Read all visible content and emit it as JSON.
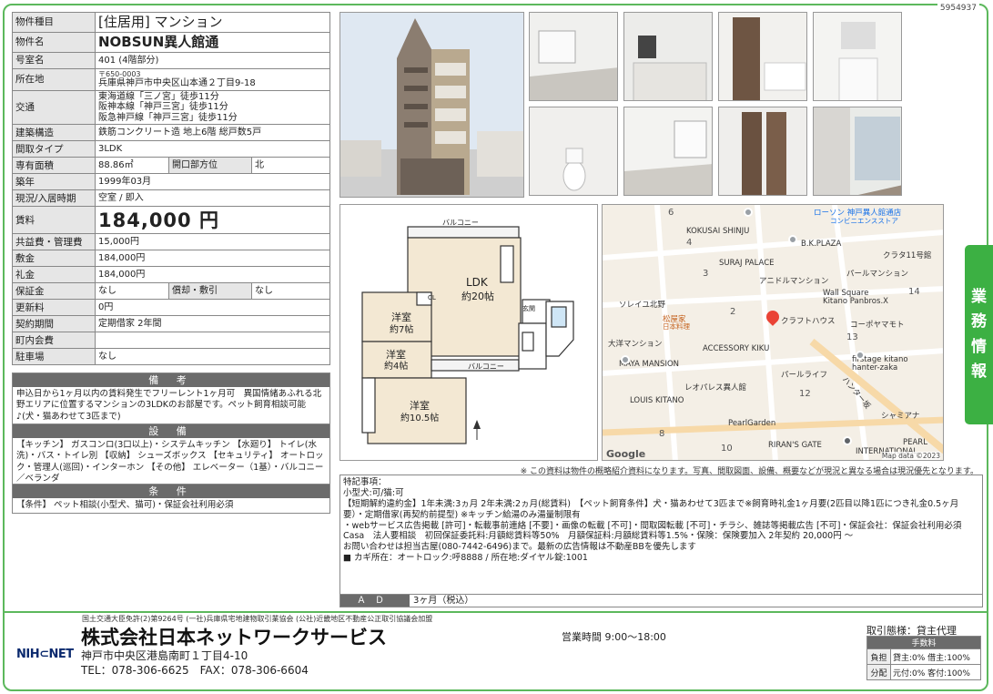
{
  "doc_id": "5954937",
  "property": {
    "type_label": "物件種目",
    "type_value": "[住居用] マンション",
    "name_label": "物件名",
    "name_value": "NOBSUN異人館通",
    "room_label": "号室名",
    "room_value": "401 (4階部分)",
    "address_label": "所在地",
    "postal": "〒650-0003",
    "address_value": "兵庫県神戸市中央区山本通２丁目9-18",
    "traffic_label": "交通",
    "traffic_lines": [
      "東海道線「三ノ宮」徒歩11分",
      "阪神本線「神戸三宮」徒歩11分",
      "阪急神戸線「神戸三宮」徒歩11分"
    ],
    "structure_label": "建築構造",
    "structure_value": "鉄筋コンクリート造 地上6階 総戸数5戸",
    "layout_label": "間取タイプ",
    "layout_value": "3LDK",
    "area_label": "専有面積",
    "area_value": "88.86㎡",
    "opening_label": "開口部方位",
    "opening_value": "北",
    "built_label": "築年",
    "built_value": "1999年03月",
    "status_label": "現況/入居時期",
    "status_value": "空室 / 即入",
    "rent_label": "賃料",
    "rent_value": "184,000 円",
    "fee_label": "共益費・管理費",
    "fee_value": "15,000円",
    "deposit_label": "敷金",
    "deposit_value": "184,000円",
    "keymoney_label": "礼金",
    "keymoney_value": "184,000円",
    "guarantee_label": "保証金",
    "guarantee_value": "なし",
    "amort_label": "償却・敷引",
    "amort_value": "なし",
    "renewal_label": "更新料",
    "renewal_value": "0円",
    "contract_label": "契約期間",
    "contract_value": "定期借家 2年間",
    "community_label": "町内会費",
    "community_value": "",
    "parking_label": "駐車場",
    "parking_value": "なし"
  },
  "notes": {
    "remarks_title": "備 考",
    "remarks_text": "申込日から1ヶ月以内の賃料発生でフリーレント1ヶ月可　異国情緒あふれる北野エリアに位置するマンションの3LDKのお部屋です。ペット飼育相談可能♪(犬・猫あわせて3匹まで)",
    "equip_title": "設 備",
    "equip_text": "【キッチン】 ガスコンロ(3口以上)・システムキッチン 【水廻り】 トイレ(水洗)・バス・トイレ別 【収納】 シューズボックス 【セキュリティ】 オートロック・管理人(巡回)・インターホン 【その他】 エレベーター（1基）・バルコニー／ベランダ",
    "cond_title": "条 件",
    "cond_text": "【条件】 ペット相談(小型犬、猫可)・保証会社利用必須"
  },
  "floorplan": {
    "balcony_top": "バルコニー",
    "balcony_mid": "バルコニー",
    "ldk": "LDK",
    "ldk_size": "約20帖",
    "room1": "洋室",
    "room1_size": "約7帖",
    "room2": "洋室",
    "room2_size": "約4帖",
    "room3": "洋室",
    "room3_size": "約10.5帖",
    "cl": "CL",
    "genkan": "玄関"
  },
  "map": {
    "labels": {
      "lawson": "ローソン 神戸異人館通店",
      "lawson_sub": "コンビニエンスストア",
      "kokusai": "KOKUSAI SHINJU",
      "bk": "B.K.PLAZA",
      "suraj": "SURAJ PALACE",
      "kurata": "クラタ11号館",
      "anidor": "アニドルマンション",
      "pearl_m": "パールマンション",
      "wall": "Wall Square",
      "kitano": "Kitano Panbros.X",
      "soleil": "ソレイユ北野",
      "matsuya": "松屋家",
      "matsuya_sub": "日本料理",
      "craft": "クラフトハウス",
      "kobeya": "コーポヤマモト",
      "taiyo": "大洋マンション",
      "accessory": "ACCESSORY KIKU",
      "firstage": "firstage kitano",
      "hanter": "hanter-zaka",
      "maya": "MAYA MANSION",
      "leo": "レオパレス異人館",
      "pearllife": "パールライフ",
      "louis": "LOUIS KITANO",
      "hunter": "ハンター坂",
      "shamiana": "シャミアナ",
      "pearlgarden": "PearlGarden",
      "riran": "RIRAN'S GATE",
      "pearl_int": "PEARL",
      "intl": "INTERNATIONAL",
      "google": "Google",
      "mapdata": "Map data ©2023"
    },
    "numbers": [
      "6",
      "4",
      "3",
      "2",
      "14",
      "13",
      "12",
      "8",
      "10"
    ]
  },
  "side_label": [
    "業",
    "務",
    "情",
    "報"
  ],
  "disclaimer": "※ この資料は物件の概略紹介資料になります。写真、間取図面、設備、概要などが現況と異なる場合は現況優先となります。",
  "special": {
    "title": "特記事項：",
    "lines": [
      "小型犬:可/猫:可",
      "【短期解約違約金】1年未満:3ヵ月 2年未満:2ヵ月(総賃料)　【ペット飼育条件】犬・猫あわせて3匹まで※飼育時礼金1ヶ月要(2匹目以降1匹につき礼金0.5ヶ月要）・定期借家(再契約前提型) ※キッチン給湯のみ湯量制限有",
      "・webサービス広告掲載 [許可]・転載事前連絡 [不要]・画像の転載 [不可]・間取図転載 [不可]・チラシ、雑誌等掲載広告 [不可]・保証会社：保証会社利用必須　Casa　法人要相談　初回保証委託料:月額総賃料等50%　月額保証料:月額総賃料等1.5%・保険：保険要加入 2年契約 20,000円 ～",
      "お問い合わせは担当古屋(080-7442-6496)まで。最新の広告情報は不動産BBを優先します",
      "■ カギ所在：オートロック:呼8888 / 所在地:ダイヤル錠:1001"
    ]
  },
  "ad": {
    "label": "ＡＤ",
    "value": "3ヶ月（税込）"
  },
  "company": {
    "license": "国土交通大臣免許(2)第9264号 (一社)兵庫県宅地建物取引業協会 (公社)近畿地区不動産公正取引協議会加盟",
    "name": "株式会社日本ネットワークサービス",
    "address": "神戸市中央区港島南町１丁目4-10",
    "tel": "TEL：078-306-6625　FAX：078-306-6604",
    "logo": "NIH⊂NET",
    "hours": "営業時間 9:00～18:00"
  },
  "trade": {
    "label": "取引態様：貸主代理",
    "fee_header": "手数料",
    "burden_label": "負担",
    "burden_value": "貸主:0% 借主:100%",
    "dist_label": "分配",
    "dist_value": "元付:0% 客付:100%"
  },
  "colors": {
    "accent": "#3cb043",
    "header_gray": "#6b6b6b",
    "label_gray": "#e6e6e6",
    "map_pin": "#ea4335"
  }
}
